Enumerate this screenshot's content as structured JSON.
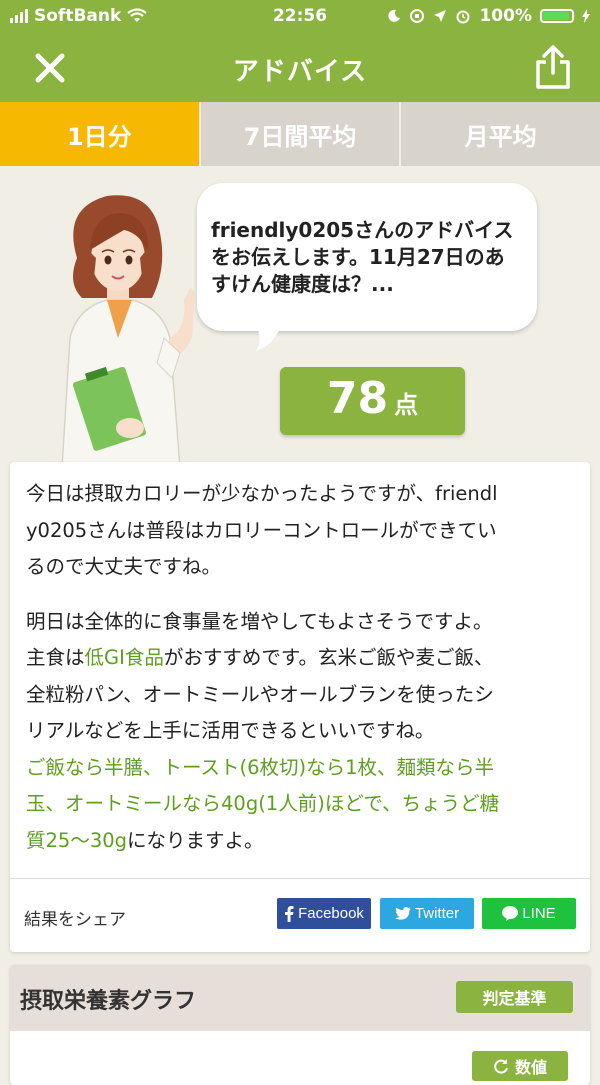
{
  "status": {
    "carrier": "SoftBank",
    "time": "22:56",
    "battery": "100%"
  },
  "header": {
    "title": "アドバイス",
    "close_icon": "close-icon",
    "share_icon": "share-upload-icon"
  },
  "tabs": [
    {
      "label": "1日分",
      "active": true
    },
    {
      "label": "7日間平均",
      "active": false
    },
    {
      "label": "月平均",
      "active": false
    }
  ],
  "advisor": {
    "bubble_lines": [
      "friendly0205さんのアドバイス",
      "をお伝えします。11月27日のあ",
      "すけん健康度は？..."
    ]
  },
  "score": {
    "value": "78",
    "unit": "点"
  },
  "advice": {
    "p1_line1": "今日は摂取カロリーが少なかったようですが、friendl",
    "p1_line2": "y0205さんは普段はカロリーコントロールができてい",
    "p1_line3": "るので大丈夫ですね。",
    "p2_line1": "明日は全体的に食事量を増やしてもよさそうですよ。",
    "p2_line2_a": "主食は",
    "p2_line2_b": "低GI食品",
    "p2_line2_c": "がおすすめです。玄米ご飯や麦ご飯、",
    "p2_line3": "全粒粉パン、オートミールやオールブランを使ったシ",
    "p2_line4": "リアルなどを上手に活用できるといいですね。",
    "p2_line5": "ご飯なら半膳、トースト(6枚切)なら1枚、麺類なら半",
    "p2_line6": "玉、オートミールなら40g(1人前)ほどで、ちょうど糖",
    "p2_line7_a": "質25〜30g",
    "p2_line7_b": "になりますよ。"
  },
  "share": {
    "label": "結果をシェア",
    "facebook": "Facebook",
    "twitter": "Twitter",
    "line": "LINE"
  },
  "nutrients": {
    "title": "摂取栄養素グラフ",
    "standard_button": "判定基準",
    "value_button": "数値"
  },
  "colors": {
    "accent_green": "#8ab43f",
    "tab_active": "#f6b800",
    "highlight_green": "#5f9f20"
  }
}
